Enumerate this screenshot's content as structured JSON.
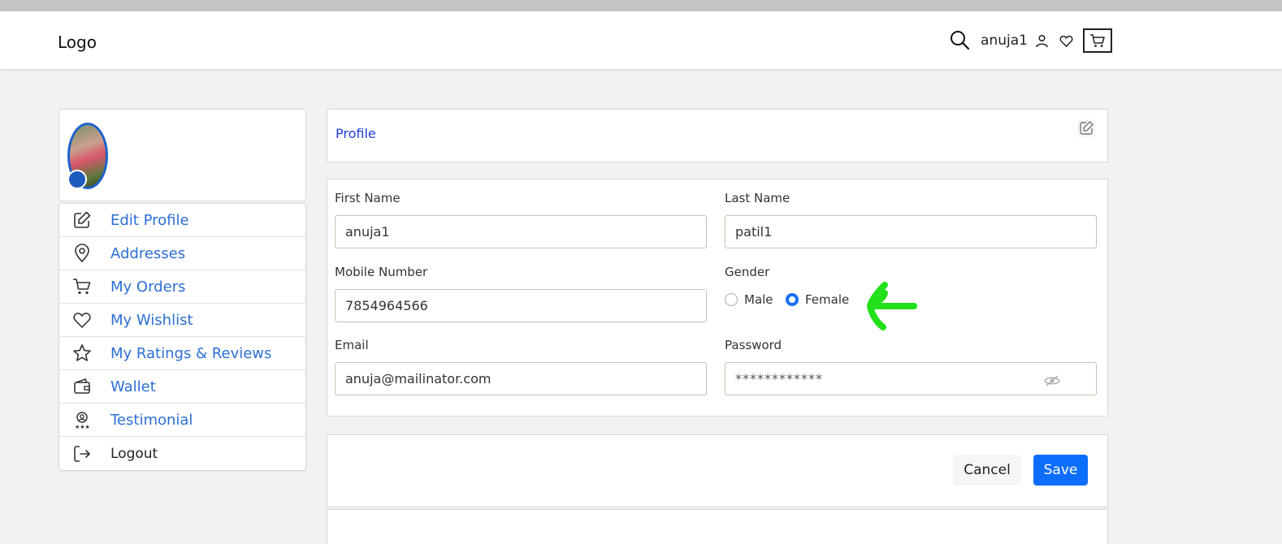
{
  "header": {
    "logo": "Logo",
    "username": "anuja1"
  },
  "sidebar": {
    "items": [
      {
        "label": "Edit Profile",
        "icon": "edit-icon"
      },
      {
        "label": "Addresses",
        "icon": "location-pin-icon"
      },
      {
        "label": "My Orders",
        "icon": "cart-icon"
      },
      {
        "label": "My Wishlist",
        "icon": "heart-icon"
      },
      {
        "label": "My Ratings & Reviews",
        "icon": "star-icon"
      },
      {
        "label": "Wallet",
        "icon": "wallet-icon"
      },
      {
        "label": "Testimonial",
        "icon": "award-icon"
      },
      {
        "label": "Logout",
        "icon": "logout-icon"
      }
    ]
  },
  "profile": {
    "title": "Profile",
    "first_name_label": "First Name",
    "first_name": "anuja1",
    "last_name_label": "Last Name",
    "last_name": "patil1",
    "mobile_label": "Mobile Number",
    "mobile": "7854964566",
    "gender_label": "Gender",
    "gender_male": "Male",
    "gender_female": "Female",
    "gender_selected": "Female",
    "email_label": "Email",
    "email": "anuja@mailinator.com",
    "password_label": "Password",
    "password_masked": "************"
  },
  "actions": {
    "cancel": "Cancel",
    "save": "Save"
  },
  "colors": {
    "primary": "#0d6efd",
    "link": "#2c6fd6",
    "title": "#1f3bd8",
    "annotation": "#22e01a"
  }
}
